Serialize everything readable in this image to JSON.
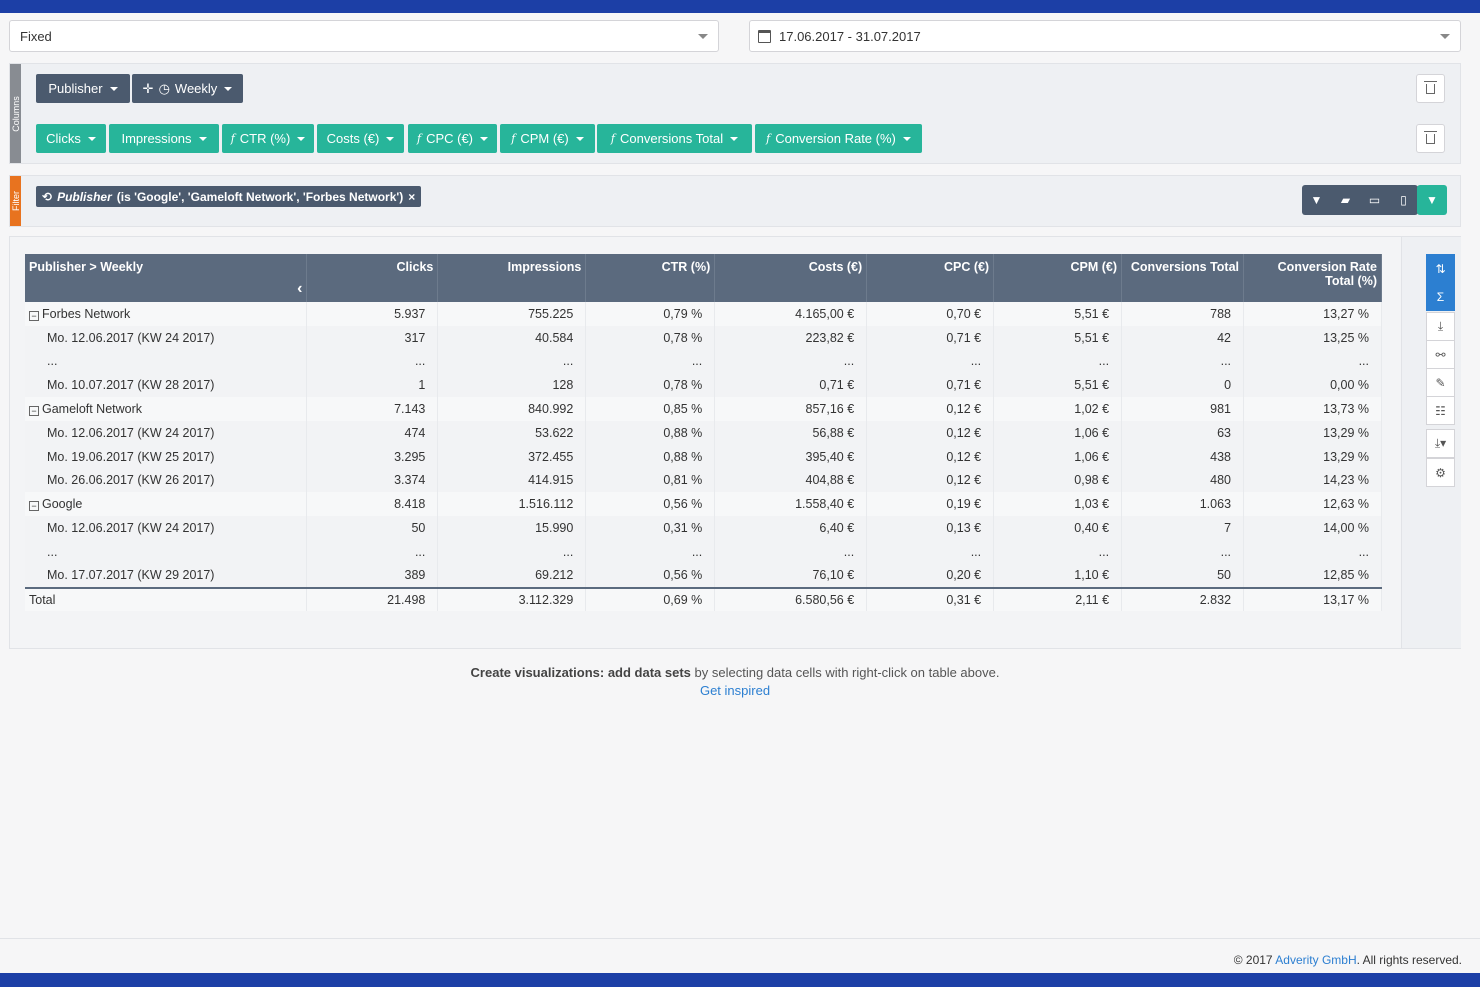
{
  "top": {
    "mode_select": "Fixed",
    "date_range": "17.06.2017 - 31.07.2017"
  },
  "columns_panel": {
    "side_label": "Columns",
    "dimensions": [
      "Publisher",
      "Weekly"
    ],
    "metrics": [
      "Clicks",
      "Impressions",
      "CTR (%)",
      "Costs (€)",
      "CPC (€)",
      "CPM (€)",
      "Conversions Total",
      "Conversion Rate (%)"
    ]
  },
  "filter_panel": {
    "side_label": "Filter",
    "chip_field": "Publisher",
    "chip_condition": "(is 'Google', 'Gameloft Network', 'Forbes Network')",
    "chip_close": "×"
  },
  "table": {
    "headers": [
      "Publisher > Weekly",
      "Clicks",
      "Impressions",
      "CTR (%)",
      "Costs (€)",
      "CPC (€)",
      "CPM (€)",
      "Conversions Total",
      "Conversion Rate Total (%)"
    ],
    "rows": [
      {
        "type": "group",
        "cells": [
          "Forbes Network",
          "5.937",
          "755.225",
          "0,79 %",
          "4.165,00 €",
          "0,70 €",
          "5,51 €",
          "788",
          "13,27 %"
        ]
      },
      {
        "type": "child",
        "cells": [
          "Mo. 12.06.2017 (KW 24 2017)",
          "317",
          "40.584",
          "0,78 %",
          "223,82 €",
          "0,71 €",
          "5,51 €",
          "42",
          "13,25 %"
        ]
      },
      {
        "type": "child",
        "cells": [
          "...",
          "...",
          "...",
          "...",
          "...",
          "...",
          "...",
          "...",
          "..."
        ]
      },
      {
        "type": "child",
        "cells": [
          "Mo. 10.07.2017 (KW 28 2017)",
          "1",
          "128",
          "0,78 %",
          "0,71 €",
          "0,71 €",
          "5,51 €",
          "0",
          "0,00 %"
        ]
      },
      {
        "type": "group",
        "cells": [
          "Gameloft Network",
          "7.143",
          "840.992",
          "0,85 %",
          "857,16 €",
          "0,12 €",
          "1,02 €",
          "981",
          "13,73 %"
        ]
      },
      {
        "type": "child",
        "cells": [
          "Mo. 12.06.2017 (KW 24 2017)",
          "474",
          "53.622",
          "0,88 %",
          "56,88 €",
          "0,12 €",
          "1,06 €",
          "63",
          "13,29 %"
        ]
      },
      {
        "type": "child",
        "cells": [
          "Mo. 19.06.2017 (KW 25 2017)",
          "3.295",
          "372.455",
          "0,88 %",
          "395,40 €",
          "0,12 €",
          "1,06 €",
          "438",
          "13,29 %"
        ]
      },
      {
        "type": "child",
        "cells": [
          "Mo. 26.06.2017 (KW 26 2017)",
          "3.374",
          "414.915",
          "0,81 %",
          "404,88 €",
          "0,12 €",
          "0,98 €",
          "480",
          "14,23 %"
        ]
      },
      {
        "type": "group",
        "cells": [
          "Google",
          "8.418",
          "1.516.112",
          "0,56 %",
          "1.558,40 €",
          "0,19 €",
          "1,03 €",
          "1.063",
          "12,63 %"
        ]
      },
      {
        "type": "child",
        "cells": [
          "Mo. 12.06.2017 (KW 24 2017)",
          "50",
          "15.990",
          "0,31 %",
          "6,40 €",
          "0,13 €",
          "0,40 €",
          "7",
          "14,00 %"
        ]
      },
      {
        "type": "child",
        "cells": [
          "...",
          "...",
          "...",
          "...",
          "...",
          "...",
          "...",
          "...",
          "..."
        ]
      },
      {
        "type": "child",
        "cells": [
          "Mo. 17.07.2017 (KW 29 2017)",
          "389",
          "69.212",
          "0,56 %",
          "76,10 €",
          "0,20 €",
          "1,10 €",
          "50",
          "12,85 %"
        ]
      },
      {
        "type": "total",
        "cells": [
          "Total",
          "21.498",
          "3.112.329",
          "0,69 %",
          "6.580,56 €",
          "0,31 €",
          "2,11 €",
          "2.832",
          "13,17 %"
        ]
      }
    ]
  },
  "hint": {
    "bold": "Create visualizations:",
    "bold2": "add data sets",
    "text": "by selecting data cells with right-click on table above.",
    "link": "Get inspired"
  },
  "footer": {
    "prefix": "© 2017",
    "company": "Adverity GmbH",
    "suffix": ". All rights reserved."
  },
  "colors": {
    "brand_bar": "#1c3fa6",
    "dimension_pill": "#4b5a6e",
    "metric_pill": "#27b59a",
    "table_header": "#5b6a7e",
    "link": "#2c7fd1"
  }
}
